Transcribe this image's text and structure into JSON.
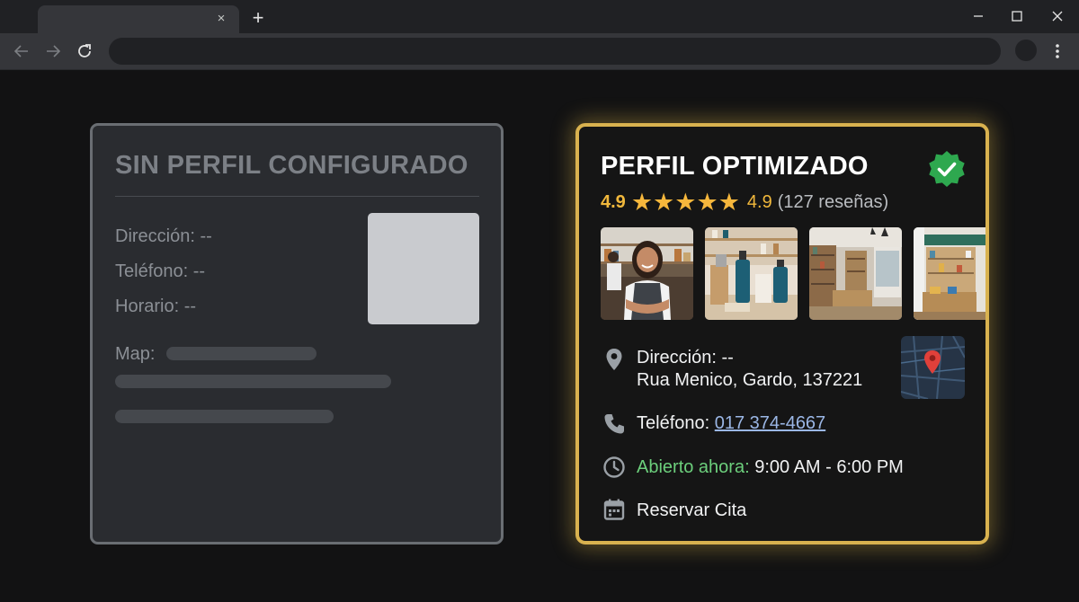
{
  "browser": {
    "tab_close_glyph": "×",
    "new_tab_glyph": "+",
    "address": "",
    "colors": {
      "frame": "#202124",
      "toolbar": "#35363a"
    }
  },
  "left_card": {
    "title": "SIN PERFIL CONFIGURADO",
    "fields": [
      {
        "label": "Dirección: --"
      },
      {
        "label": "Teléfono: --"
      },
      {
        "label": "Horario: --"
      }
    ],
    "map_label": "Map:"
  },
  "right_card": {
    "title": "PERFIL OPTIMIZADO",
    "rating": "4.9",
    "stars": 5,
    "rating_repeat": "4.9",
    "reviews": "(127 reseñas)",
    "photos": [
      "smiling-employee",
      "cosmetic-products",
      "store-interior",
      "store-shelves"
    ],
    "address_label": "Dirección: --",
    "address": "Rua Menico, Gardo, 137221",
    "phone_label": "Teléfono: ",
    "phone": "017 374-4667",
    "open_label": "Abierto ahora:",
    "hours": " 9:00 AM - 6:00 PM",
    "booking": "Reservar Cita",
    "colors": {
      "accent_border": "#d9b24f",
      "star": "#f6b73c",
      "open": "#6ccf7c",
      "link": "#9bb7e6",
      "verified": "#2ea84f"
    },
    "icons": [
      "verified-check-icon",
      "location-pin-icon",
      "phone-icon",
      "clock-icon",
      "calendar-icon",
      "map-marker-icon"
    ]
  }
}
